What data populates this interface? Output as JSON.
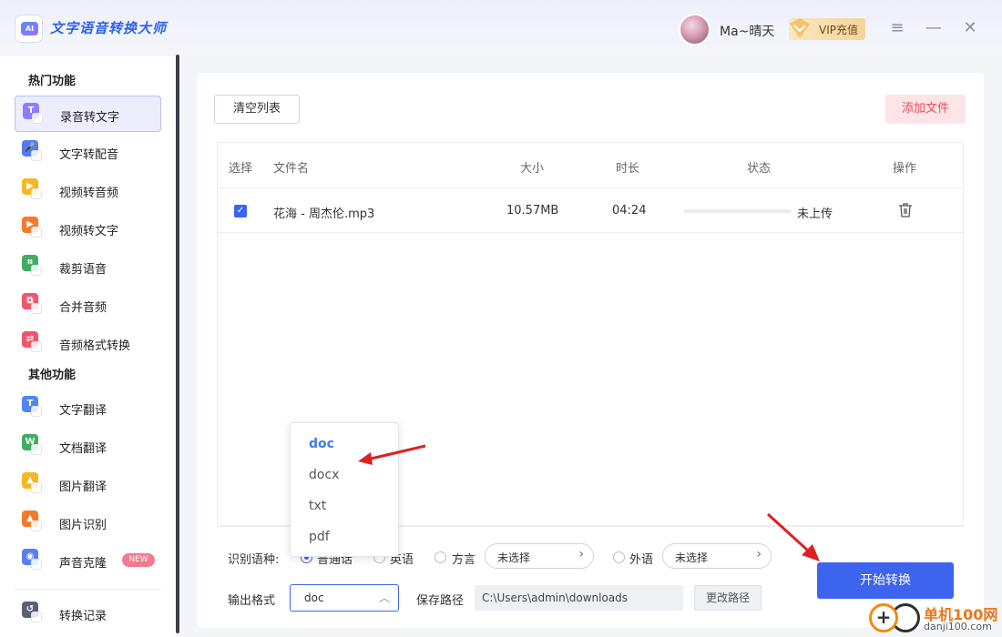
{
  "app": {
    "title": "文字语音转换大师",
    "logo_text": "AI"
  },
  "user": {
    "name": "Ma~晴天",
    "vip_label": "VIP充值"
  },
  "window_controls": {
    "menu": "≡",
    "minimize": "—",
    "close": "✕"
  },
  "sidebar": {
    "hot_title": "热门功能",
    "hot_items": [
      {
        "label": "录音转文字",
        "icon": "T",
        "color": "#8f7bff",
        "active": true
      },
      {
        "label": "文字转配音",
        "icon": "🎤",
        "color": "#4f7df3"
      },
      {
        "label": "视频转音频",
        "icon": "▶",
        "color": "#f5b825"
      },
      {
        "label": "视频转文字",
        "icon": "▶",
        "color": "#f57a2c"
      },
      {
        "label": "裁剪语音",
        "icon": "⌗",
        "color": "#3fae62"
      },
      {
        "label": "合并音频",
        "icon": "⧉",
        "color": "#f2566c"
      },
      {
        "label": "音频格式转换",
        "icon": "⇄",
        "color": "#f2566c"
      }
    ],
    "other_title": "其他功能",
    "other_items": [
      {
        "label": "文字翻译",
        "icon": "T",
        "color": "#4f86f3"
      },
      {
        "label": "文档翻译",
        "icon": "W",
        "color": "#3fae62"
      },
      {
        "label": "图片翻译",
        "icon": "▲",
        "color": "#f5b825"
      },
      {
        "label": "图片识别",
        "icon": "▲",
        "color": "#f57a2c"
      },
      {
        "label": "声音克隆",
        "icon": "◉",
        "color": "#5b7df3",
        "badge": "NEW"
      }
    ],
    "history_label": "转换记录"
  },
  "toolbar": {
    "clear_label": "清空列表",
    "add_label": "添加文件"
  },
  "table": {
    "headers": {
      "select": "选择",
      "name": "文件名",
      "size": "大小",
      "duration": "时长",
      "status": "状态",
      "action": "操作"
    },
    "rows": [
      {
        "checked": true,
        "name": "花海 - 周杰伦.mp3",
        "size": "10.57MB",
        "duration": "04:24",
        "progress": 0,
        "status": "未上传"
      }
    ]
  },
  "options": {
    "lang_label": "识别语种:",
    "lang_mandarin": "普通话",
    "lang_english": "英语",
    "lang_dialect": "方言",
    "dialect_select": "未选择",
    "lang_foreign": "外语",
    "foreign_select": "未选择",
    "format_label": "输出格式",
    "format_value": "doc",
    "path_label": "保存路径",
    "path_value": "C:\\Users\\admin\\downloads",
    "change_path": "更改路径",
    "start": "开始转换"
  },
  "format_dropdown": {
    "options": [
      "doc",
      "docx",
      "txt",
      "pdf"
    ],
    "selected": "doc"
  },
  "watermark": {
    "title": "单机100网",
    "url": "danji100.com"
  },
  "colors": {
    "accent": "#3d64ee",
    "add_button_text": "#ea4a5a",
    "arrow": "#e02020"
  }
}
